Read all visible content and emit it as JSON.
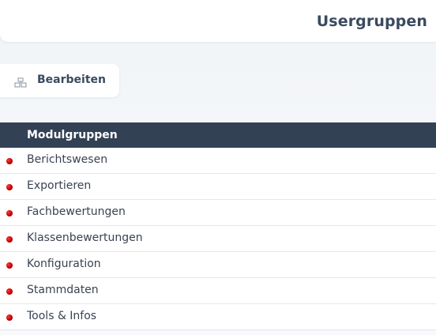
{
  "header": {
    "title": "Usergruppen"
  },
  "toolbar": {
    "edit_label": "Bearbeiten",
    "edit_icon": "edit-icon"
  },
  "table": {
    "header": "Modulgruppen",
    "rows": [
      {
        "label": "Berichtswesen"
      },
      {
        "label": "Exportieren"
      },
      {
        "label": "Fachbewertungen"
      },
      {
        "label": "Klassenbewertungen"
      },
      {
        "label": "Konfiguration"
      },
      {
        "label": "Stammdaten"
      },
      {
        "label": "Tools & Infos"
      }
    ]
  },
  "colors": {
    "header_bg": "#334155",
    "bullet": "#c00000",
    "title_text": "#3a4a5f"
  }
}
